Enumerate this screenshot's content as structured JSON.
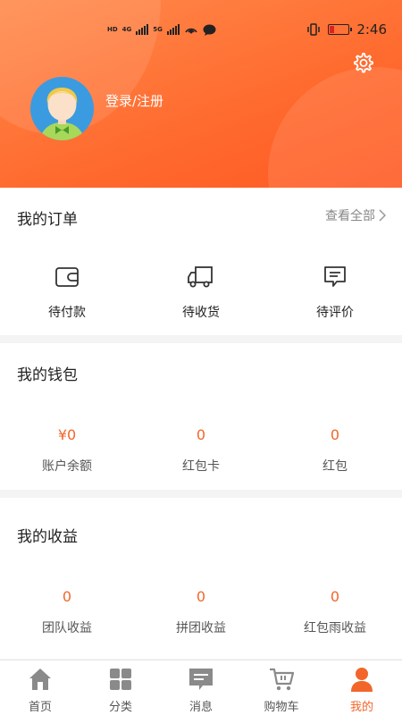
{
  "status_bar": {
    "tags": [
      "HD",
      "4G",
      "5G"
    ],
    "time": "2:46",
    "battery_level": 0.25
  },
  "profile": {
    "login_label": "登录/注册"
  },
  "orders": {
    "title": "我的订单",
    "view_all": "查看全部",
    "items": [
      {
        "label": "待付款",
        "icon": "wallet-icon"
      },
      {
        "label": "待收货",
        "icon": "truck-icon"
      },
      {
        "label": "待评价",
        "icon": "comment-icon"
      }
    ]
  },
  "wallet": {
    "title": "我的钱包",
    "items": [
      {
        "value": "¥0",
        "label": "账户余额"
      },
      {
        "value": "0",
        "label": "红包卡"
      },
      {
        "value": "0",
        "label": "红包"
      }
    ]
  },
  "earnings": {
    "title": "我的收益",
    "items": [
      {
        "value": "0",
        "label": "团队收益"
      },
      {
        "value": "0",
        "label": "拼团收益"
      },
      {
        "value": "0",
        "label": "红包雨收益"
      }
    ]
  },
  "tabbar": {
    "items": [
      {
        "label": "首页",
        "icon": "home-icon"
      },
      {
        "label": "分类",
        "icon": "grid-icon"
      },
      {
        "label": "消息",
        "icon": "message-icon"
      },
      {
        "label": "购物车",
        "icon": "cart-icon"
      },
      {
        "label": "我的",
        "icon": "person-icon",
        "active": true
      }
    ]
  },
  "colors": {
    "accent": "#f2662a",
    "header_gradient_start": "#ff8a4c",
    "header_gradient_end": "#ff5a24"
  }
}
